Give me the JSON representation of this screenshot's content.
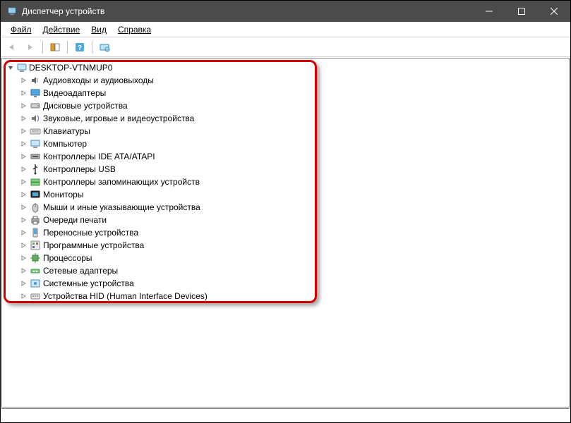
{
  "window": {
    "title": "Диспетчер устройств"
  },
  "menu": {
    "file": "Файл",
    "action": "Действие",
    "view": "Вид",
    "help": "Справка"
  },
  "tree": {
    "root": "DESKTOP-VTNMUP0",
    "items": [
      {
        "label": "Аудиовходы и аудиовыходы",
        "icon": "speaker"
      },
      {
        "label": "Видеоадаптеры",
        "icon": "display"
      },
      {
        "label": "Дисковые устройства",
        "icon": "disk"
      },
      {
        "label": "Звуковые, игровые и видеоустройства",
        "icon": "sound"
      },
      {
        "label": "Клавиатуры",
        "icon": "keyboard"
      },
      {
        "label": "Компьютер",
        "icon": "computer"
      },
      {
        "label": "Контроллеры IDE ATA/ATAPI",
        "icon": "ide"
      },
      {
        "label": "Контроллеры USB",
        "icon": "usb"
      },
      {
        "label": "Контроллеры запоминающих устройств",
        "icon": "storage"
      },
      {
        "label": "Мониторы",
        "icon": "monitor"
      },
      {
        "label": "Мыши и иные указывающие устройства",
        "icon": "mouse"
      },
      {
        "label": "Очереди печати",
        "icon": "printer"
      },
      {
        "label": "Переносные устройства",
        "icon": "portable"
      },
      {
        "label": "Программные устройства",
        "icon": "software"
      },
      {
        "label": "Процессоры",
        "icon": "cpu"
      },
      {
        "label": "Сетевые адаптеры",
        "icon": "network"
      },
      {
        "label": "Системные устройства",
        "icon": "system"
      },
      {
        "label": "Устройства HID (Human Interface Devices)",
        "icon": "hid"
      }
    ]
  }
}
